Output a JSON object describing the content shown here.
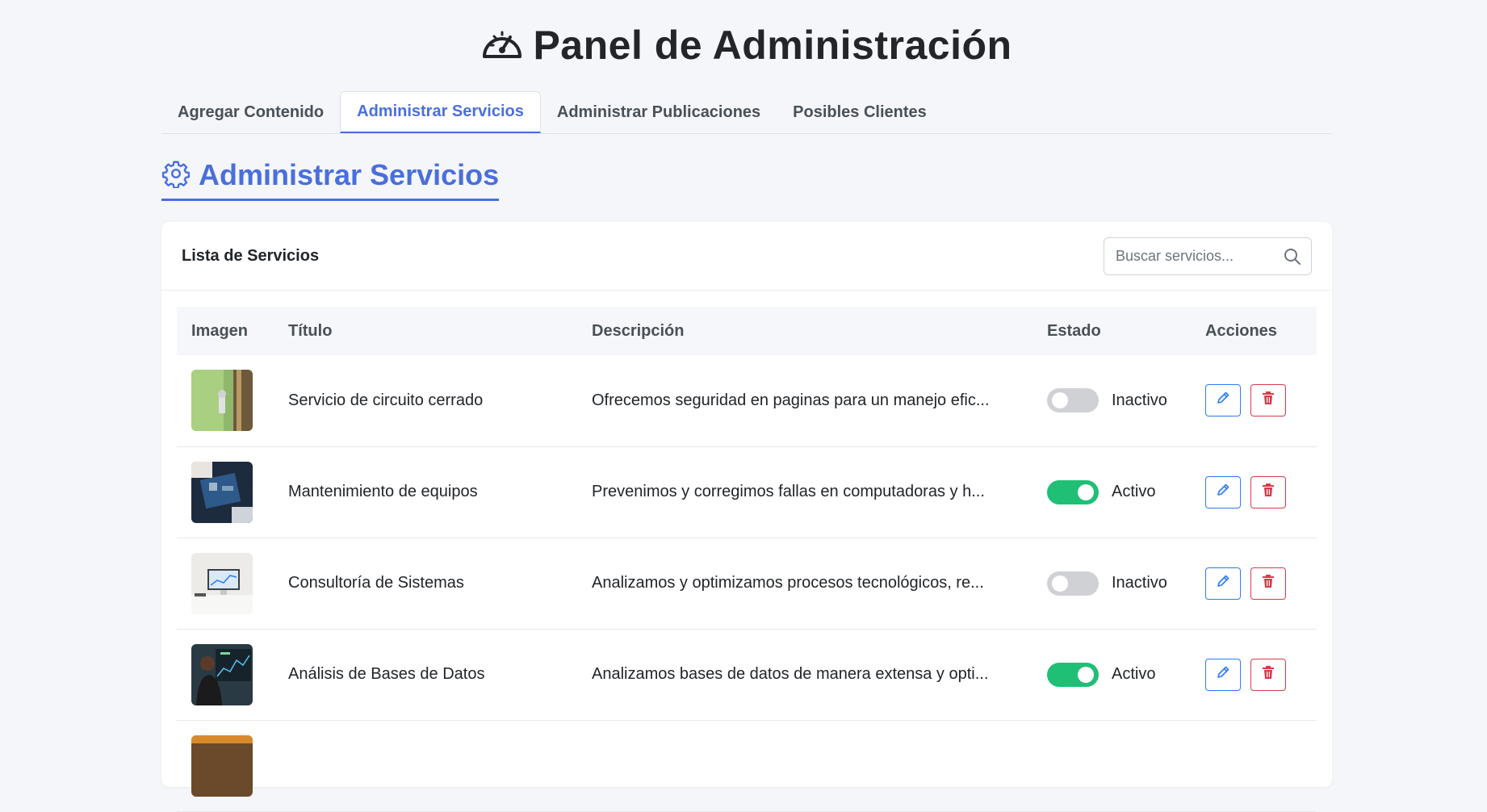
{
  "header": {
    "title": "Panel de Administración",
    "icon": "gauge-icon"
  },
  "tabs": [
    {
      "label": "Agregar Contenido",
      "active": false
    },
    {
      "label": "Administrar Servicios",
      "active": true
    },
    {
      "label": "Administrar Publicaciones",
      "active": false
    },
    {
      "label": "Posibles Clientes",
      "active": false
    }
  ],
  "section": {
    "title": "Administrar Servicios",
    "icon": "gear-icon"
  },
  "card": {
    "title": "Lista de Servicios",
    "search": {
      "placeholder": "Buscar servicios...",
      "value": ""
    }
  },
  "table": {
    "headers": [
      "Imagen",
      "Título",
      "Descripción",
      "Estado",
      "Acciones"
    ],
    "rows": [
      {
        "title": "Servicio de circuito cerrado",
        "description": "Ofrecemos seguridad en paginas para un manejo efic...",
        "status": "Inactivo",
        "active": false
      },
      {
        "title": "Mantenimiento de equipos",
        "description": "Prevenimos y corregimos fallas en computadoras y h...",
        "status": "Activo",
        "active": true
      },
      {
        "title": "Consultoría de Sistemas",
        "description": "Analizamos y optimizamos procesos tecnológicos, re...",
        "status": "Inactivo",
        "active": false
      },
      {
        "title": "Análisis de Bases de Datos",
        "description": "Analizamos bases de datos de manera extensa y opti...",
        "status": "Activo",
        "active": true
      }
    ]
  },
  "colors": {
    "accent": "#4a6fdc",
    "active_toggle": "#1fbf75",
    "inactive_toggle": "#cfd1d4",
    "edit": "#2b7bf2",
    "delete": "#d93a4a"
  }
}
